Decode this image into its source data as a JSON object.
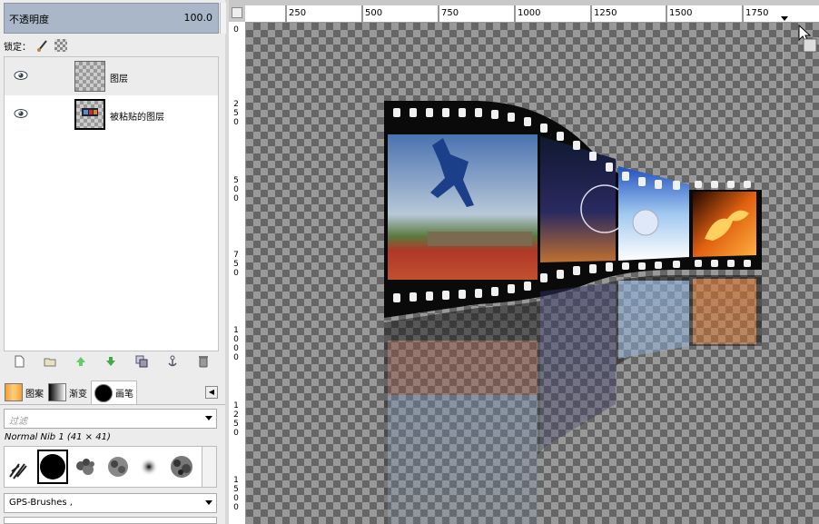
{
  "opacity": {
    "label": "不透明度",
    "value": "100.0"
  },
  "lock": {
    "label": "锁定："
  },
  "layers": [
    {
      "name": "图层",
      "visible": true,
      "selected": true
    },
    {
      "name": "被粘贴的图层",
      "visible": true,
      "selected": false
    }
  ],
  "layer_toolbar": [
    "new-layer-icon",
    "new-layer-group-icon",
    "raise-layer-icon",
    "lower-layer-icon",
    "duplicate-layer-icon",
    "anchor-layer-icon",
    "delete-layer-icon"
  ],
  "tabs": [
    {
      "label": "图案",
      "active": false
    },
    {
      "label": "渐变",
      "active": false
    },
    {
      "label": "画笔",
      "active": true
    }
  ],
  "brushes": {
    "filter_placeholder": "过滤",
    "selected_name": "Normal Nib 1 (41 × 41)",
    "tag": "GPS-Brushes ,"
  },
  "ruler": {
    "top": [
      "250",
      "500",
      "750",
      "1000",
      "1250",
      "1500",
      "1750"
    ],
    "left": [
      [
        "0"
      ],
      [
        "2",
        "5",
        "0"
      ],
      [
        "5",
        "0",
        "0"
      ],
      [
        "7",
        "5",
        "0"
      ],
      [
        "1",
        "0",
        "0",
        "0"
      ],
      [
        "1",
        "2",
        "5",
        "0"
      ],
      [
        "1",
        "5",
        "0",
        "0"
      ]
    ]
  },
  "colors": {
    "opacity_bar": "#a9b7c9",
    "checker_dark": "#666666",
    "checker_light": "#999999"
  }
}
